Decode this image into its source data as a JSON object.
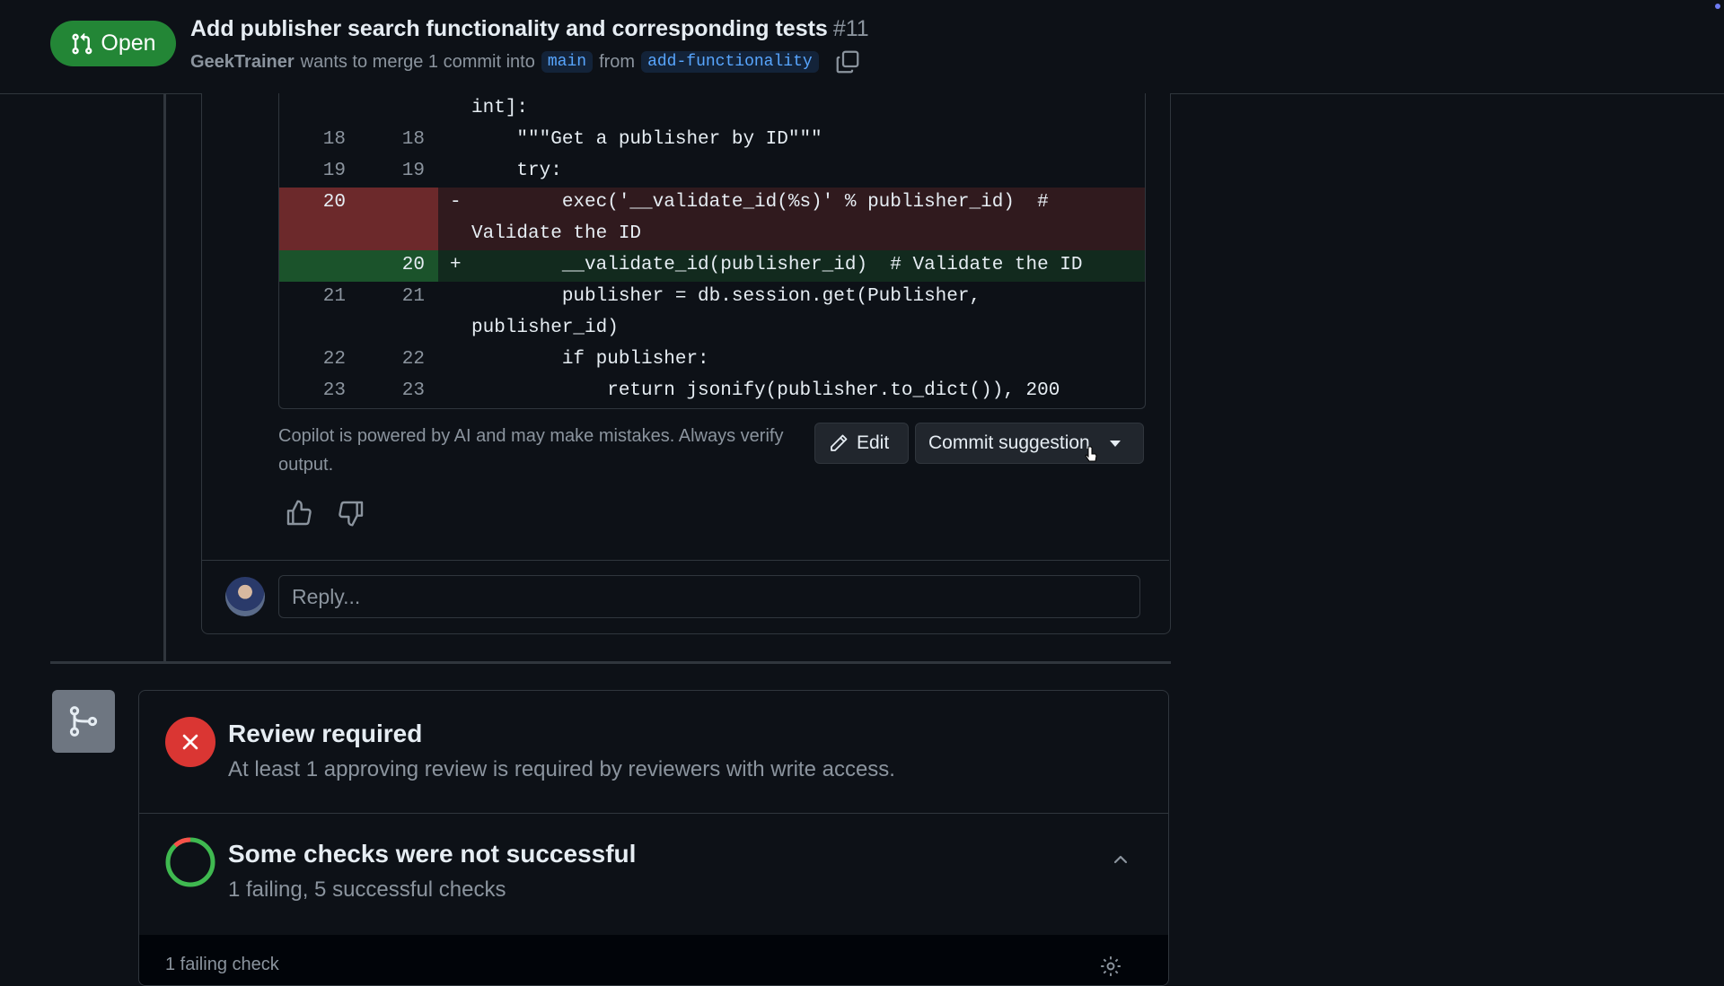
{
  "header": {
    "state_label": "Open",
    "title": "Add publisher search functionality and corresponding tests",
    "number": "#11",
    "author": "GeekTrainer",
    "merge_text": "wants to merge 1 commit into",
    "base_branch": "main",
    "from_text": "from",
    "head_branch": "add-functionality"
  },
  "diff": {
    "lines": [
      {
        "old": "",
        "new": "",
        "sign": "",
        "text": "int]:"
      },
      {
        "old": "18",
        "new": "18",
        "sign": "",
        "text": "    \"\"\"Get a publisher by ID\"\"\""
      },
      {
        "old": "19",
        "new": "19",
        "sign": "",
        "text": "    try:"
      },
      {
        "old": "20",
        "new": "",
        "sign": "-",
        "text": "        exec('__validate_id(%s)' % publisher_id)  #"
      },
      {
        "old": "",
        "new": "",
        "sign": "",
        "text": "Validate the ID"
      },
      {
        "old": "",
        "new": "20",
        "sign": "+",
        "text": "        __validate_id(publisher_id)  # Validate the ID"
      },
      {
        "old": "21",
        "new": "21",
        "sign": "",
        "text": "        publisher = db.session.get(Publisher,"
      },
      {
        "old": "",
        "new": "",
        "sign": "",
        "text": "publisher_id)"
      },
      {
        "old": "22",
        "new": "22",
        "sign": "",
        "text": "        if publisher:"
      },
      {
        "old": "23",
        "new": "23",
        "sign": "",
        "text": "            return jsonify(publisher.to_dict()), 200"
      }
    ]
  },
  "suggestion": {
    "disclaimer": "Copilot is powered by AI and may make mistakes. Always verify output.",
    "edit_label": "Edit",
    "commit_label": "Commit suggestion"
  },
  "reply": {
    "placeholder": "Reply..."
  },
  "merge": {
    "review_title": "Review required",
    "review_desc": "At least 1 approving review is required by reviewers with write access.",
    "checks_title": "Some checks were not successful",
    "checks_desc": "1 failing, 5 successful checks",
    "failing_label": "1 failing check"
  },
  "colors": {
    "open_green": "#238636",
    "fail_red": "#da3633",
    "link_blue": "#58a6ff"
  }
}
